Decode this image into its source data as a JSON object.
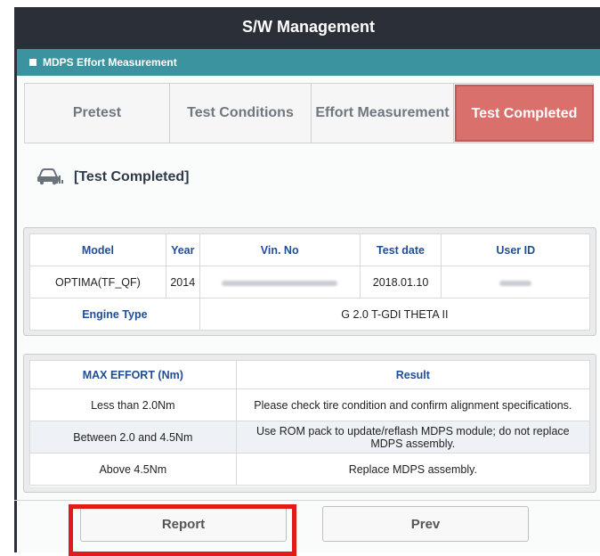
{
  "window": {
    "title": "S/W Management"
  },
  "subheader": {
    "title": "MDPS Effort Measurement"
  },
  "tabs": [
    {
      "label": "Pretest",
      "active": false
    },
    {
      "label": "Test Conditions",
      "active": false
    },
    {
      "label": "Effort Measurement",
      "active": false
    },
    {
      "label": "Test Completed",
      "active": true
    }
  ],
  "section": {
    "title": "[Test Completed]",
    "icon": "car-diagnostic-icon"
  },
  "vehicle_info": {
    "headers": [
      "Model",
      "Year",
      "Vin. No",
      "Test date",
      "User ID"
    ],
    "row": {
      "model": "OPTIMA(TF_QF)",
      "year": "2014",
      "vin": "",
      "test_date": "2018.01.10",
      "user_id": ""
    },
    "engine_label": "Engine Type",
    "engine_value": "G 2.0 T-GDI THETA II"
  },
  "result_table": {
    "headers": [
      "MAX EFFORT (Nm)",
      "Result"
    ],
    "rows": [
      {
        "effort": "Less than 2.0Nm",
        "result": "Please check tire condition and confirm alignment specifications."
      },
      {
        "effort": "Between 2.0 and 4.5Nm",
        "result": "Use ROM pack to update/reflash MDPS module; do not replace MDPS assembly."
      },
      {
        "effort": "Above 4.5Nm",
        "result": "Replace MDPS assembly."
      }
    ]
  },
  "buttons": {
    "report": "Report",
    "prev": "Prev"
  },
  "colors": {
    "titlebar": "#2a2f38",
    "subbar": "#3b93a0",
    "active_tab": "#d9706b",
    "header_text": "#1f4e96",
    "highlight": "#e11a1a"
  }
}
